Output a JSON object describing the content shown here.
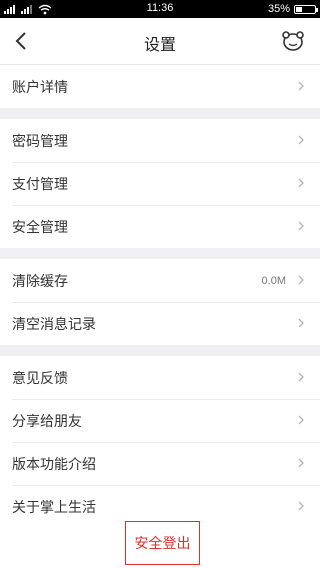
{
  "status_bar": {
    "carrier_icons": "signal-wifi-icons",
    "time": "11:36",
    "battery_text": "35%",
    "battery_level": 0.35
  },
  "nav": {
    "title": "设置"
  },
  "groups": [
    {
      "items": [
        {
          "label": "账户详情"
        }
      ]
    },
    {
      "items": [
        {
          "label": "密码管理"
        },
        {
          "label": "支付管理"
        },
        {
          "label": "安全管理"
        }
      ]
    },
    {
      "items": [
        {
          "label": "清除缓存",
          "value": "0.0M"
        },
        {
          "label": "清空消息记录"
        }
      ]
    },
    {
      "items": [
        {
          "label": "意见反馈"
        },
        {
          "label": "分享给朋友"
        },
        {
          "label": "版本功能介绍"
        },
        {
          "label": "关于掌上生活"
        }
      ]
    }
  ],
  "logout": {
    "label": "安全登出"
  },
  "colors": {
    "accent": "#e0302a"
  }
}
